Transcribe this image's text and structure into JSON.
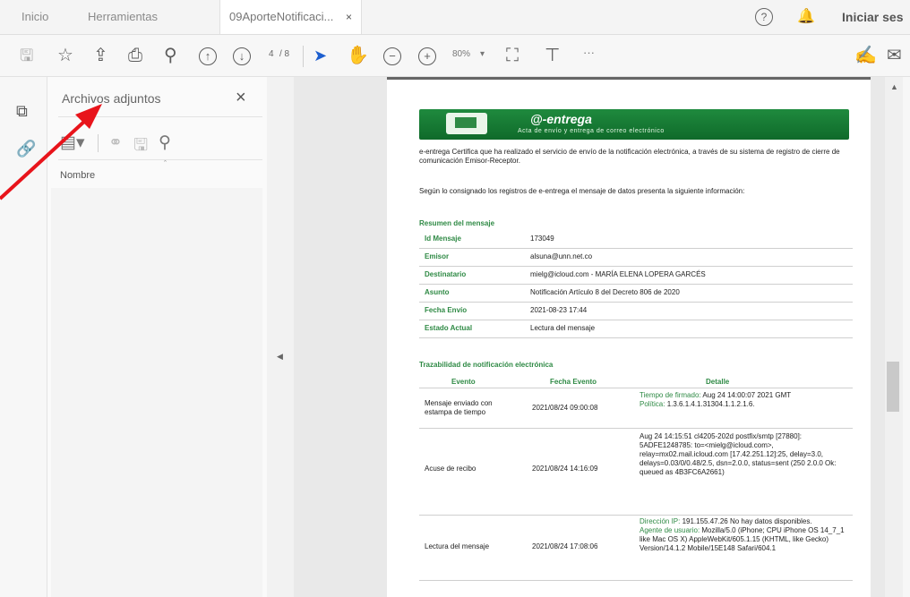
{
  "tabs": {
    "home": "Inicio",
    "tools": "Herramientas",
    "doc": "09AporteNotificaci...",
    "close": "×"
  },
  "topbar": {
    "help": "?",
    "signin": "Iniciar ses"
  },
  "toolbar": {
    "page_current": "4",
    "page_total": "/ 8",
    "zoom": "80%",
    "more": "···"
  },
  "panel": {
    "title": "Archivos adjuntos",
    "close": "×",
    "column_name": "Nombre",
    "sort_indicator": "ˆ"
  },
  "document": {
    "banner_title": "@-entrega",
    "banner_subtitle": "Acta de envío y entrega de correo electrónico",
    "intro": "e-entrega Certifica que ha realizado el servicio de envío de la notificación electrónica, a través de su sistema de registro de cierre de comunicación Emisor-Receptor.",
    "consigned": "Según lo consignado los registros de e-entrega el mensaje de datos presenta la siguiente información:",
    "summary_title": "Resumen del mensaje",
    "summary": [
      {
        "label": "Id Mensaje",
        "value": "173049"
      },
      {
        "label": "Emisor",
        "value": "alsuna@unn.net.co"
      },
      {
        "label": "Destinatario",
        "value": "mielg@icloud.com - MARÍA ELENA LOPERA GARCÉS"
      },
      {
        "label": "Asunto",
        "value": "Notificación Artículo 8 del Decreto 806 de 2020"
      },
      {
        "label": "Fecha Envío",
        "value": "2021-08-23 17:44"
      },
      {
        "label": "Estado Actual",
        "value": "Lectura del mensaje"
      }
    ],
    "trace_title": "Trazabilidad de notificación electrónica",
    "headers": {
      "event": "Evento",
      "date": "Fecha Evento",
      "detail": "Detalle"
    },
    "rows": [
      {
        "event": "Mensaje enviado con estampa de tiempo",
        "date": "2021/08/24 09:00:08",
        "d1_label": "Tiempo de firmado:",
        "d1_text": " Aug 24 14:00:07 2021 GMT",
        "d2_label": "Política:",
        "d2_text": " 1.3.6.1.4.1.31304.1.1.2.1.6."
      },
      {
        "event": "Acuse de recibo",
        "date": "2021/08/24 14:16:09",
        "detail": "Aug 24 14:15:51 cl4205-202d postfix/smtp [27880]: 5ADFE1248785: to=<mielg@icloud.com>, relay=mx02.mail.icloud.com [17.42.251.12]:25, delay=3.0, delays=0.03/0/0.48/2.5, dsn=2.0.0, status=sent (250 2.0.0 Ok: queued as 4B3FC6A2661)"
      },
      {
        "event": "Lectura del mensaje",
        "date": "2021/08/24 17:08:06",
        "d1_label": "Dirección IP:",
        "d1_text": " 191.155.47.26 No hay datos disponibles.",
        "d2_label": "Agente de usuario:",
        "d2_text": " Mozilla/5.0 (iPhone; CPU iPhone OS 14_7_1 like Mac OS X) AppleWebKit/605.1.15 (KHTML, like Gecko) Version/14.1.2 Mobile/15E148 Safari/604.1"
      }
    ]
  },
  "colors": {
    "accent_green": "#2f8a45",
    "arrow_red": "#e8141b"
  },
  "icons": [
    "save-icon",
    "star-icon",
    "upload-icon",
    "print-icon",
    "zoom-search-icon",
    "page-up-icon",
    "page-down-icon",
    "select-cursor-icon",
    "hand-icon",
    "zoom-out-icon",
    "zoom-in-icon",
    "page-fit-icon",
    "stamp-icon",
    "sign-icon",
    "mail-icon",
    "attachments-icon",
    "bookmark-icon"
  ]
}
